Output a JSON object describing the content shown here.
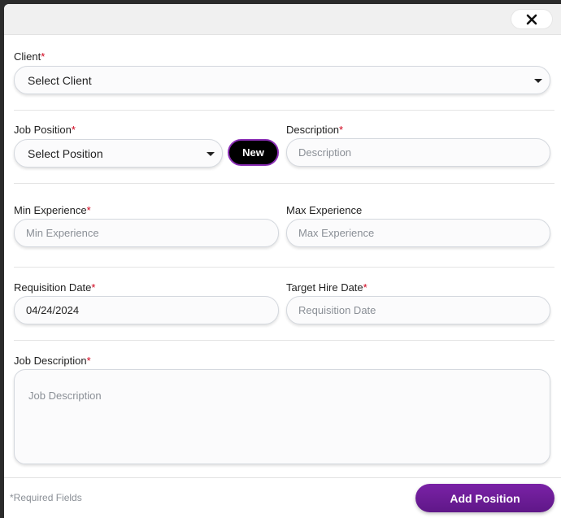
{
  "header": {
    "close_icon": "close-icon"
  },
  "client": {
    "label": "Client",
    "selected": "Select Client"
  },
  "job_position": {
    "label": "Job Position",
    "selected": "Select Position",
    "new_label": "New"
  },
  "description": {
    "label": "Description",
    "placeholder": "Description",
    "value": ""
  },
  "min_experience": {
    "label": "Min Experience",
    "placeholder": "Min Experience",
    "value": ""
  },
  "max_experience": {
    "label": "Max Experience",
    "placeholder": "Max Experience",
    "value": ""
  },
  "requisition_date": {
    "label": "Requisition Date",
    "placeholder": "Requisition Date",
    "value": "04/24/2024"
  },
  "target_hire_date": {
    "label": "Target Hire Date",
    "placeholder": "Requisition Date",
    "value": ""
  },
  "job_description": {
    "label": "Job Description",
    "placeholder": "Job Description",
    "value": ""
  },
  "required_marker": "*",
  "footer": {
    "note": "*Required Fields",
    "submit_label": "Add Position"
  },
  "colors": {
    "accent": "#7a22a6",
    "required": "#d0021b"
  }
}
